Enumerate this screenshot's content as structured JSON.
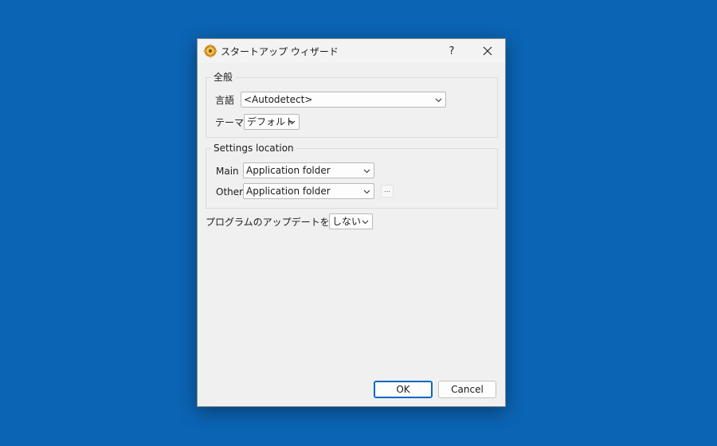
{
  "window": {
    "title": "スタートアップ ウィザード",
    "help_glyph": "?",
    "close_glyph": "✕"
  },
  "general": {
    "group_title": "全般",
    "language_label": "言語",
    "language_value": "<Autodetect>",
    "theme_label": "テーマ",
    "theme_value": "デフォルト"
  },
  "settings_location": {
    "group_title": "Settings location",
    "main_label": "Main",
    "main_value": "Application folder",
    "other_label": "Other",
    "other_value": "Application folder",
    "browse_label": "..."
  },
  "update_check": {
    "label": "プログラムのアップデートをチェック",
    "value": "しない"
  },
  "buttons": {
    "ok": "OK",
    "cancel": "Cancel"
  }
}
